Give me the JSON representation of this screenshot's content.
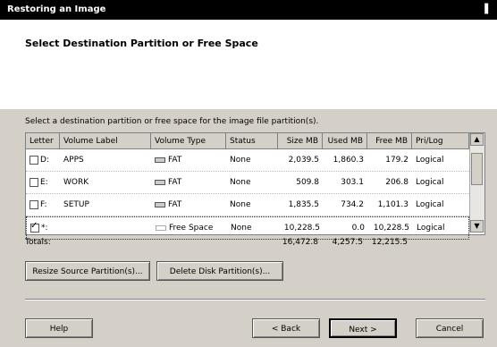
{
  "window": {
    "title": "Restoring an Image",
    "title_right": "▌"
  },
  "header": {
    "title": "Select Destination Partition or Free Space"
  },
  "instruction": "Select a destination partition or free space for the image file partition(s).",
  "table": {
    "columns": [
      "Letter",
      "Volume Label",
      "Volume Type",
      "Status",
      "Size MB",
      "Used MB",
      "Free MB",
      "Pri/Log"
    ],
    "rows": [
      {
        "checked": false,
        "letter": "D:",
        "label": "APPS",
        "type": "FAT",
        "status": "None",
        "size": "2,039.5",
        "used": "1,860.3",
        "free": "179.2",
        "prilog": "Logical",
        "selected": false
      },
      {
        "checked": false,
        "letter": "E:",
        "label": "WORK",
        "type": "FAT",
        "status": "None",
        "size": "509.8",
        "used": "303.1",
        "free": "206.8",
        "prilog": "Logical",
        "selected": false
      },
      {
        "checked": false,
        "letter": "F:",
        "label": "SETUP",
        "type": "FAT",
        "status": "None",
        "size": "1,835.5",
        "used": "734.2",
        "free": "1,101.3",
        "prilog": "Logical",
        "selected": false
      },
      {
        "checked": true,
        "letter": "*:",
        "label": "",
        "type": "Free Space",
        "status": "None",
        "size": "10,228.5",
        "used": "0.0",
        "free": "10,228.5",
        "prilog": "Logical",
        "selected": true
      }
    ]
  },
  "totals": {
    "label": "Totals:",
    "size": "16,472.8",
    "used": "4,257.5",
    "free": "12,215.5"
  },
  "buttons": {
    "resize": "Resize Source Partition(s)...",
    "delete": "Delete Disk Partition(s)...",
    "help": "Help",
    "back": "< Back",
    "next": "Next >",
    "cancel": "Cancel"
  },
  "colors": {
    "dialog_bg": "#d4d0c8",
    "title_bg": "#000000"
  },
  "icons": {
    "fat_type": "drive-icon",
    "free_type": "free-space-icon",
    "scroll_up": "up-arrow-icon",
    "scroll_down": "down-arrow-icon"
  }
}
